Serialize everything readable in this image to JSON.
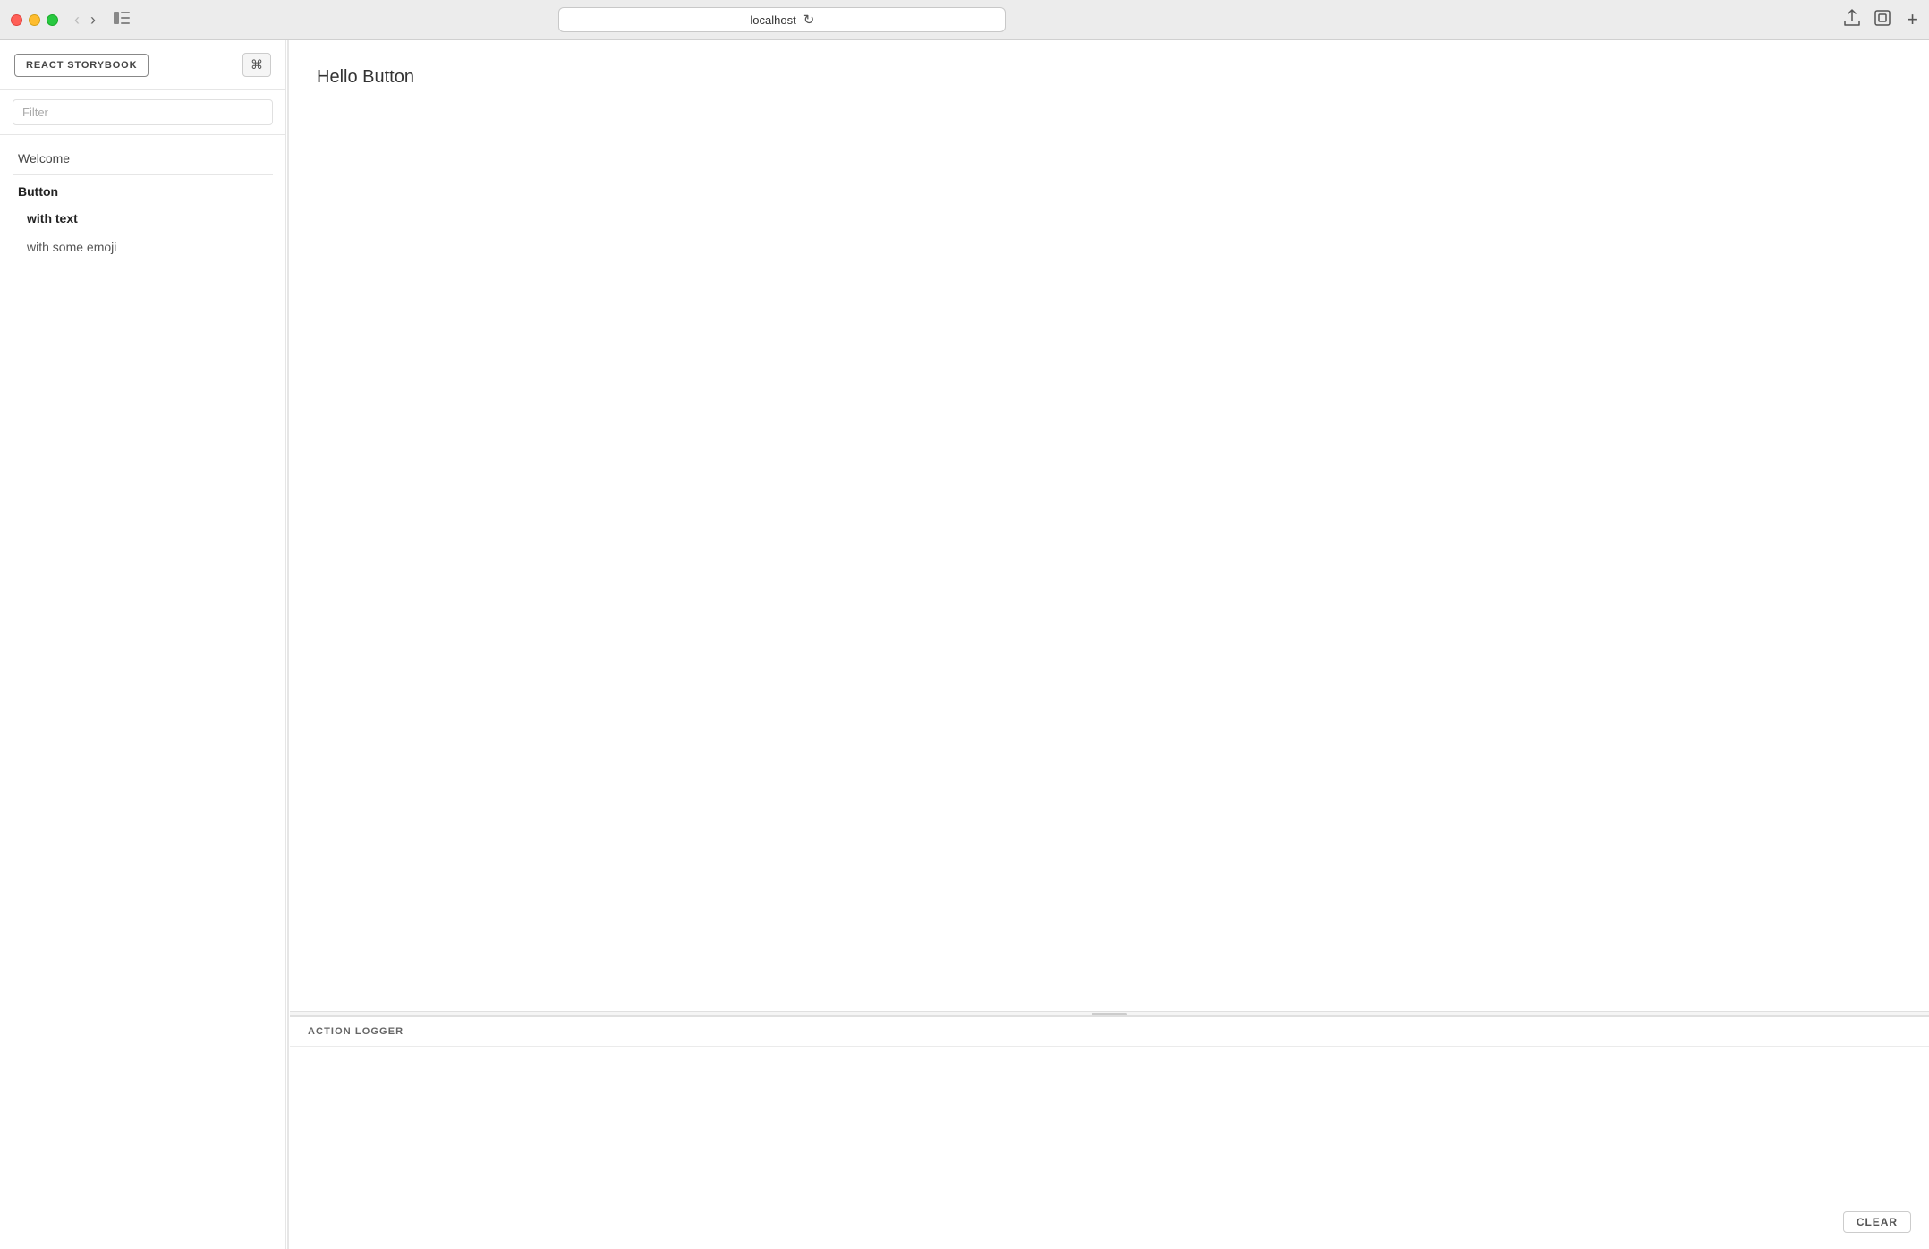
{
  "browser": {
    "url": "localhost",
    "back_btn": "‹",
    "forward_btn": "›",
    "reload_btn": "↻",
    "share_icon": "share",
    "tabs_icon": "tabs",
    "plus_icon": "+"
  },
  "sidebar": {
    "logo_label": "REACT STORYBOOK",
    "keyboard_shortcut": "⌘",
    "filter_placeholder": "Filter",
    "nav_items": [
      {
        "id": "welcome",
        "label": "Welcome",
        "type": "section",
        "bold": false
      },
      {
        "id": "button",
        "label": "Button",
        "type": "section",
        "bold": true
      },
      {
        "id": "with-text",
        "label": "with text",
        "type": "item",
        "active": true
      },
      {
        "id": "with-some-emoji",
        "label": "with some emoji",
        "type": "item",
        "active": false
      }
    ]
  },
  "preview": {
    "story_title": "Hello Button"
  },
  "action_logger": {
    "title": "ACTION LOGGER",
    "clear_label": "CLEAR"
  }
}
